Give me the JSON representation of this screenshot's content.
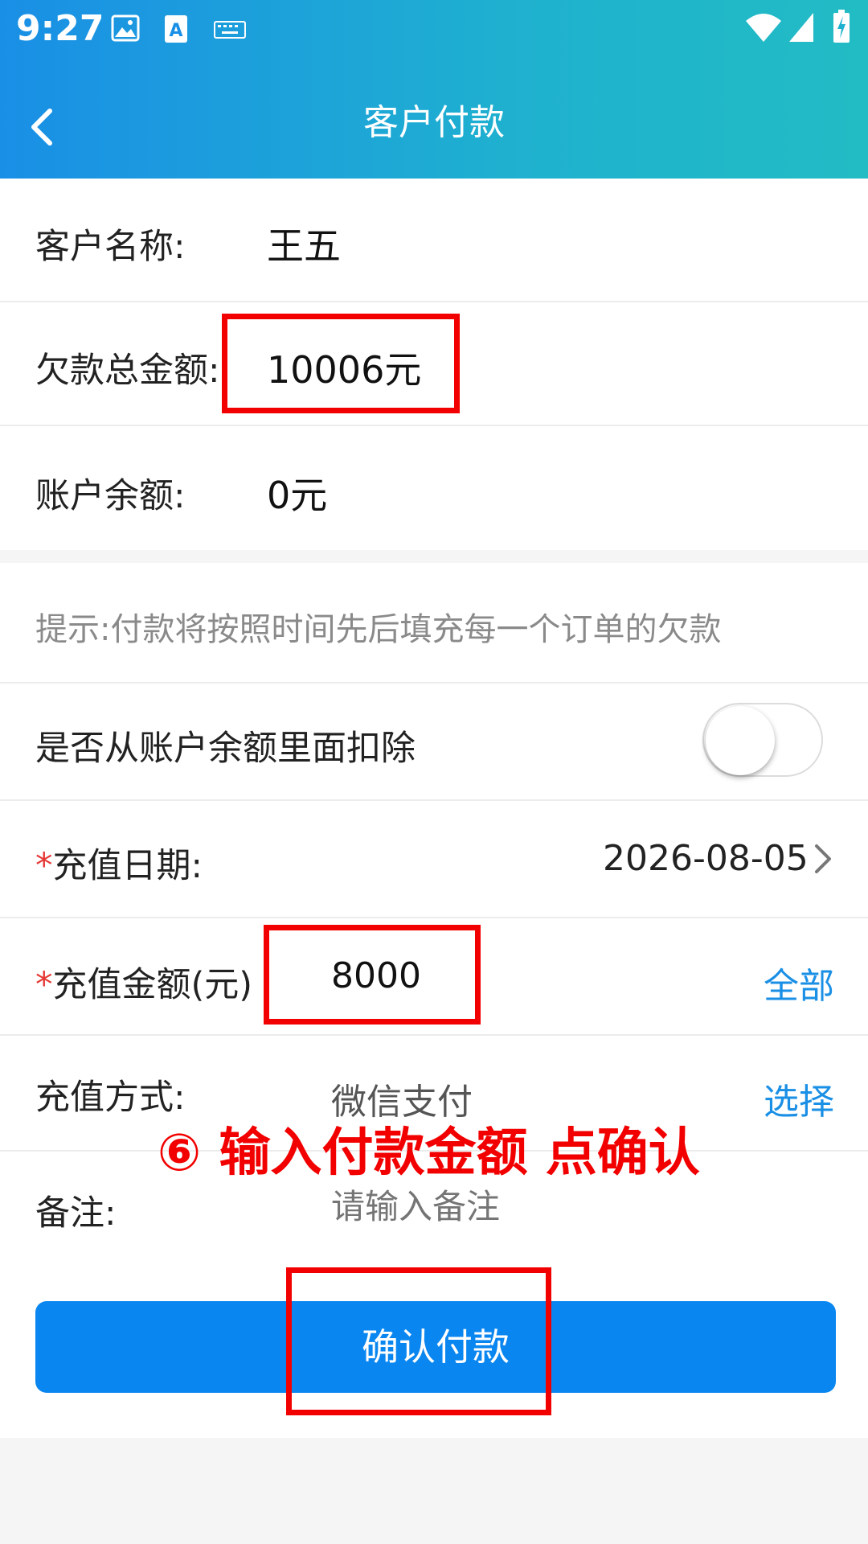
{
  "status_bar": {
    "time": "9:27",
    "left_icons": [
      "image-icon",
      "font-a-icon",
      "keyboard-icon"
    ],
    "right_icons": [
      "wifi-icon",
      "signal-icon",
      "battery-charging-icon"
    ]
  },
  "header": {
    "back_icon": "chevron-left-icon",
    "title": "客户付款"
  },
  "customer_info": {
    "name_label": "客户名称:",
    "name_value": "王五",
    "debt_label": "欠款总金额:",
    "debt_value": "10006元",
    "balance_label": "账户余额:",
    "balance_value": "0元"
  },
  "form": {
    "hint": "提示:付款将按照时间先后填充每一个订单的欠款",
    "deduct_label": "是否从账户余额里面扣除",
    "deduct_enabled": false,
    "date_required_mark": "*",
    "date_label": "充值日期:",
    "date_value": "2026-08-05",
    "amount_required_mark": "*",
    "amount_label": "充值金额(元)",
    "amount_value": "8000",
    "amount_all_link": "全部",
    "method_label": "充值方式:",
    "method_value": "微信支付",
    "method_select_link": "选择",
    "remark_label": "备注:",
    "remark_placeholder": "请输入备注",
    "confirm_button": "确认付款"
  },
  "annotation": {
    "text": "⑥ 输入付款金额 点确认",
    "color": "#f20000"
  },
  "colors": {
    "header_start": "#1a8fe6",
    "header_end": "#22bcc4",
    "primary_button": "#0a86f0",
    "link": "#1a8fe6",
    "required": "#e53935"
  }
}
